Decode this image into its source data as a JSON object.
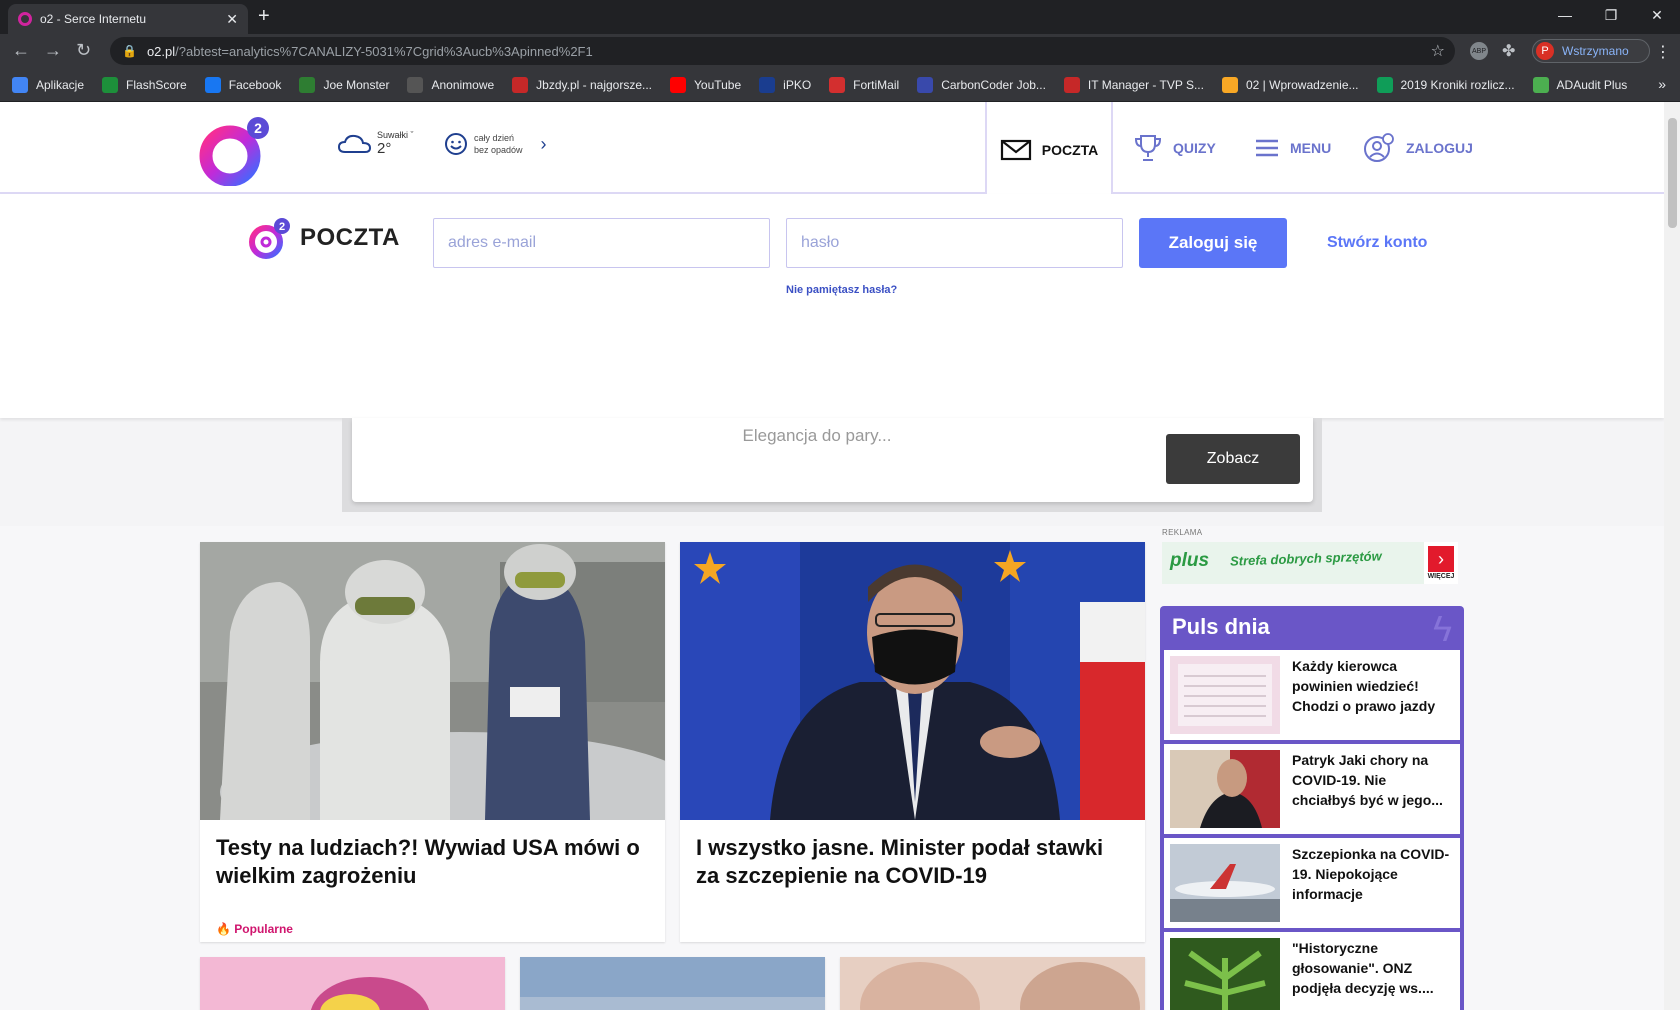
{
  "browser": {
    "tab_title": "o2 - Serce Internetu",
    "url_host": "o2.pl",
    "url_path": "/?abtest=analytics%7CANALIZY-5031%7Cgrid%3Aucb%3Apinned%2F1",
    "profile_label": "Wstrzymano",
    "profile_initial": "P",
    "bookmarks": [
      {
        "label": "Aplikacje",
        "color": "#4285f4"
      },
      {
        "label": "FlashScore",
        "color": "#1d8f3a"
      },
      {
        "label": "Facebook",
        "color": "#1877f2"
      },
      {
        "label": "Joe Monster",
        "color": "#2e7d32"
      },
      {
        "label": "Anonimowe",
        "color": "#555555"
      },
      {
        "label": "Jbzdy.pl - najgorsze...",
        "color": "#c62828"
      },
      {
        "label": "YouTube",
        "color": "#ff0000"
      },
      {
        "label": "iPKO",
        "color": "#1a3d8f"
      },
      {
        "label": "FortiMail",
        "color": "#d32f2f"
      },
      {
        "label": "CarbonCoder Job...",
        "color": "#3949ab"
      },
      {
        "label": "IT Manager - TVP S...",
        "color": "#c62828"
      },
      {
        "label": "02 | Wprowadzenie...",
        "color": "#f9a825"
      },
      {
        "label": "2019 Kroniki rozlicz...",
        "color": "#0f9d58"
      },
      {
        "label": "ADAudit Plus",
        "color": "#4caf50"
      }
    ]
  },
  "header": {
    "weather_city": "Suwałki",
    "weather_temp": "2°",
    "forecast_line1": "cały dzień",
    "forecast_line2": "bez opadów",
    "nav_poczta": "POCZTA",
    "nav_quizy": "QUIZY",
    "nav_menu": "MENU",
    "nav_zaloguj": "ZALOGUJ"
  },
  "login": {
    "brand": "POCZTA",
    "email_placeholder": "adres e-mail",
    "password_placeholder": "hasło",
    "submit_label": "Zaloguj się",
    "create_account": "Stwórz konto",
    "forgot_password": "Nie pamiętasz hasła?"
  },
  "ad": {
    "text": "Elegancja do pary...",
    "button": "Zobacz"
  },
  "cards": [
    {
      "headline": "Testy na ludziach?! Wywiad USA mówi o wielkim zagrożeniu",
      "tag": "Popularne"
    },
    {
      "headline": "I wszystko jasne. Minister podał stawki za szczepienie na COVID-19"
    }
  ],
  "sidebar": {
    "reklama": "REKLAMA",
    "banner_brand": "plus",
    "banner_text": "Strefa dobrych sprzętów",
    "banner_more": "WIĘCEJ",
    "puls_title": "Puls dnia",
    "puls_items": [
      {
        "text": "Każdy kierowca powinien wiedzieć! Chodzi o prawo jazdy"
      },
      {
        "text": "Patryk Jaki chory na COVID-19. Nie chciałbyś być w jego..."
      },
      {
        "text": "Szczepionka na COVID-19. Niepokojące informacje"
      },
      {
        "text": "\"Historyczne głosowanie\". ONZ podjęła decyzję ws...."
      }
    ]
  },
  "colors": {
    "accent": "#5b76f7",
    "brand_pink": "#d0156e",
    "puls_purple": "#6a56c7"
  }
}
